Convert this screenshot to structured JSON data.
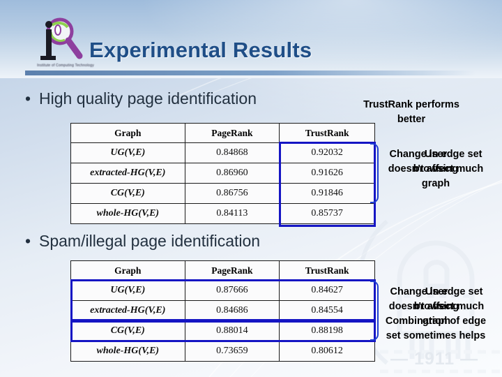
{
  "header": {
    "title": "Experimental Results",
    "logo_caption": "Institute of Computing Technology"
  },
  "watermark": {
    "year": "— 1911 —"
  },
  "bullets": [
    {
      "marker": "•",
      "text": "High quality page identification"
    },
    {
      "marker": "•",
      "text": "Spam/illegal page identification"
    }
  ],
  "tables": [
    {
      "columns": [
        "Graph",
        "PageRank",
        "TrustRank"
      ],
      "rows": [
        {
          "graph": "UG(V,E)",
          "pagerank": "0.84868",
          "trustrank": "0.92032"
        },
        {
          "graph": "extracted-HG(V,E)",
          "pagerank": "0.86960",
          "trustrank": "0.91626"
        },
        {
          "graph": "CG(V,E)",
          "pagerank": "0.86756",
          "trustrank": "0.91846"
        },
        {
          "graph": "whole-HG(V,E)",
          "pagerank": "0.84113",
          "trustrank": "0.85737"
        }
      ]
    },
    {
      "columns": [
        "Graph",
        "PageRank",
        "TrustRank"
      ],
      "rows": [
        {
          "graph": "UG(V,E)",
          "pagerank": "0.87666",
          "trustrank": "0.84627"
        },
        {
          "graph": "extracted-HG(V,E)",
          "pagerank": "0.84686",
          "trustrank": "0.84554"
        },
        {
          "graph": "CG(V,E)",
          "pagerank": "0.88014",
          "trustrank": "0.88198"
        },
        {
          "graph": "whole-HG(V,E)",
          "pagerank": "0.73659",
          "trustrank": "0.80612"
        }
      ]
    }
  ],
  "callouts": {
    "top": "TrustRank performs\nbetter",
    "change_edge_set_1": "Change in edge set\ndoesn't affect much",
    "user_browsing_graph_1": "User\nbrowsing\ngraph",
    "change_edge_set_2": "Change in edge set\ndoesn't affect much",
    "user_browsing_graph_2": "User\nbrowsing\ngraph",
    "combination": "Combination of edge\nset sometimes helps"
  },
  "colors": {
    "title": "#1f4e87",
    "highlight_box": "#1515c4",
    "brace": "#1f3fd0",
    "logo_purple": "#8e3f9e",
    "logo_green": "#8fd14f"
  }
}
